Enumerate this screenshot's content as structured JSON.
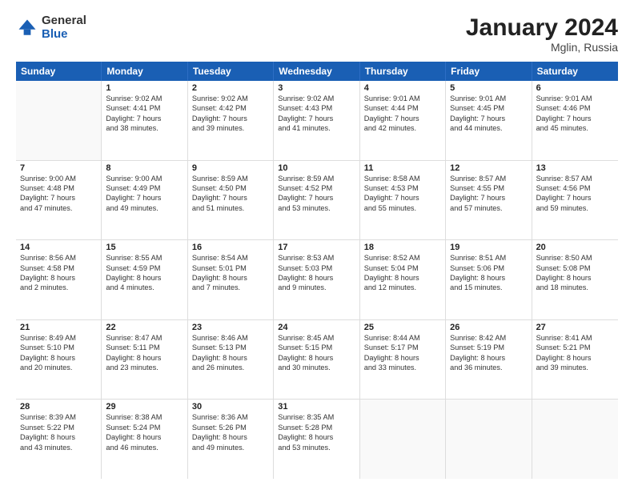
{
  "logo": {
    "general": "General",
    "blue": "Blue"
  },
  "title": "January 2024",
  "location": "Mglin, Russia",
  "days": [
    "Sunday",
    "Monday",
    "Tuesday",
    "Wednesday",
    "Thursday",
    "Friday",
    "Saturday"
  ],
  "weeks": [
    [
      {
        "day": "",
        "lines": []
      },
      {
        "day": "1",
        "lines": [
          "Sunrise: 9:02 AM",
          "Sunset: 4:41 PM",
          "Daylight: 7 hours",
          "and 38 minutes."
        ]
      },
      {
        "day": "2",
        "lines": [
          "Sunrise: 9:02 AM",
          "Sunset: 4:42 PM",
          "Daylight: 7 hours",
          "and 39 minutes."
        ]
      },
      {
        "day": "3",
        "lines": [
          "Sunrise: 9:02 AM",
          "Sunset: 4:43 PM",
          "Daylight: 7 hours",
          "and 41 minutes."
        ]
      },
      {
        "day": "4",
        "lines": [
          "Sunrise: 9:01 AM",
          "Sunset: 4:44 PM",
          "Daylight: 7 hours",
          "and 42 minutes."
        ]
      },
      {
        "day": "5",
        "lines": [
          "Sunrise: 9:01 AM",
          "Sunset: 4:45 PM",
          "Daylight: 7 hours",
          "and 44 minutes."
        ]
      },
      {
        "day": "6",
        "lines": [
          "Sunrise: 9:01 AM",
          "Sunset: 4:46 PM",
          "Daylight: 7 hours",
          "and 45 minutes."
        ]
      }
    ],
    [
      {
        "day": "7",
        "lines": [
          "Sunrise: 9:00 AM",
          "Sunset: 4:48 PM",
          "Daylight: 7 hours",
          "and 47 minutes."
        ]
      },
      {
        "day": "8",
        "lines": [
          "Sunrise: 9:00 AM",
          "Sunset: 4:49 PM",
          "Daylight: 7 hours",
          "and 49 minutes."
        ]
      },
      {
        "day": "9",
        "lines": [
          "Sunrise: 8:59 AM",
          "Sunset: 4:50 PM",
          "Daylight: 7 hours",
          "and 51 minutes."
        ]
      },
      {
        "day": "10",
        "lines": [
          "Sunrise: 8:59 AM",
          "Sunset: 4:52 PM",
          "Daylight: 7 hours",
          "and 53 minutes."
        ]
      },
      {
        "day": "11",
        "lines": [
          "Sunrise: 8:58 AM",
          "Sunset: 4:53 PM",
          "Daylight: 7 hours",
          "and 55 minutes."
        ]
      },
      {
        "day": "12",
        "lines": [
          "Sunrise: 8:57 AM",
          "Sunset: 4:55 PM",
          "Daylight: 7 hours",
          "and 57 minutes."
        ]
      },
      {
        "day": "13",
        "lines": [
          "Sunrise: 8:57 AM",
          "Sunset: 4:56 PM",
          "Daylight: 7 hours",
          "and 59 minutes."
        ]
      }
    ],
    [
      {
        "day": "14",
        "lines": [
          "Sunrise: 8:56 AM",
          "Sunset: 4:58 PM",
          "Daylight: 8 hours",
          "and 2 minutes."
        ]
      },
      {
        "day": "15",
        "lines": [
          "Sunrise: 8:55 AM",
          "Sunset: 4:59 PM",
          "Daylight: 8 hours",
          "and 4 minutes."
        ]
      },
      {
        "day": "16",
        "lines": [
          "Sunrise: 8:54 AM",
          "Sunset: 5:01 PM",
          "Daylight: 8 hours",
          "and 7 minutes."
        ]
      },
      {
        "day": "17",
        "lines": [
          "Sunrise: 8:53 AM",
          "Sunset: 5:03 PM",
          "Daylight: 8 hours",
          "and 9 minutes."
        ]
      },
      {
        "day": "18",
        "lines": [
          "Sunrise: 8:52 AM",
          "Sunset: 5:04 PM",
          "Daylight: 8 hours",
          "and 12 minutes."
        ]
      },
      {
        "day": "19",
        "lines": [
          "Sunrise: 8:51 AM",
          "Sunset: 5:06 PM",
          "Daylight: 8 hours",
          "and 15 minutes."
        ]
      },
      {
        "day": "20",
        "lines": [
          "Sunrise: 8:50 AM",
          "Sunset: 5:08 PM",
          "Daylight: 8 hours",
          "and 18 minutes."
        ]
      }
    ],
    [
      {
        "day": "21",
        "lines": [
          "Sunrise: 8:49 AM",
          "Sunset: 5:10 PM",
          "Daylight: 8 hours",
          "and 20 minutes."
        ]
      },
      {
        "day": "22",
        "lines": [
          "Sunrise: 8:47 AM",
          "Sunset: 5:11 PM",
          "Daylight: 8 hours",
          "and 23 minutes."
        ]
      },
      {
        "day": "23",
        "lines": [
          "Sunrise: 8:46 AM",
          "Sunset: 5:13 PM",
          "Daylight: 8 hours",
          "and 26 minutes."
        ]
      },
      {
        "day": "24",
        "lines": [
          "Sunrise: 8:45 AM",
          "Sunset: 5:15 PM",
          "Daylight: 8 hours",
          "and 30 minutes."
        ]
      },
      {
        "day": "25",
        "lines": [
          "Sunrise: 8:44 AM",
          "Sunset: 5:17 PM",
          "Daylight: 8 hours",
          "and 33 minutes."
        ]
      },
      {
        "day": "26",
        "lines": [
          "Sunrise: 8:42 AM",
          "Sunset: 5:19 PM",
          "Daylight: 8 hours",
          "and 36 minutes."
        ]
      },
      {
        "day": "27",
        "lines": [
          "Sunrise: 8:41 AM",
          "Sunset: 5:21 PM",
          "Daylight: 8 hours",
          "and 39 minutes."
        ]
      }
    ],
    [
      {
        "day": "28",
        "lines": [
          "Sunrise: 8:39 AM",
          "Sunset: 5:22 PM",
          "Daylight: 8 hours",
          "and 43 minutes."
        ]
      },
      {
        "day": "29",
        "lines": [
          "Sunrise: 8:38 AM",
          "Sunset: 5:24 PM",
          "Daylight: 8 hours",
          "and 46 minutes."
        ]
      },
      {
        "day": "30",
        "lines": [
          "Sunrise: 8:36 AM",
          "Sunset: 5:26 PM",
          "Daylight: 8 hours",
          "and 49 minutes."
        ]
      },
      {
        "day": "31",
        "lines": [
          "Sunrise: 8:35 AM",
          "Sunset: 5:28 PM",
          "Daylight: 8 hours",
          "and 53 minutes."
        ]
      },
      {
        "day": "",
        "lines": []
      },
      {
        "day": "",
        "lines": []
      },
      {
        "day": "",
        "lines": []
      }
    ]
  ]
}
